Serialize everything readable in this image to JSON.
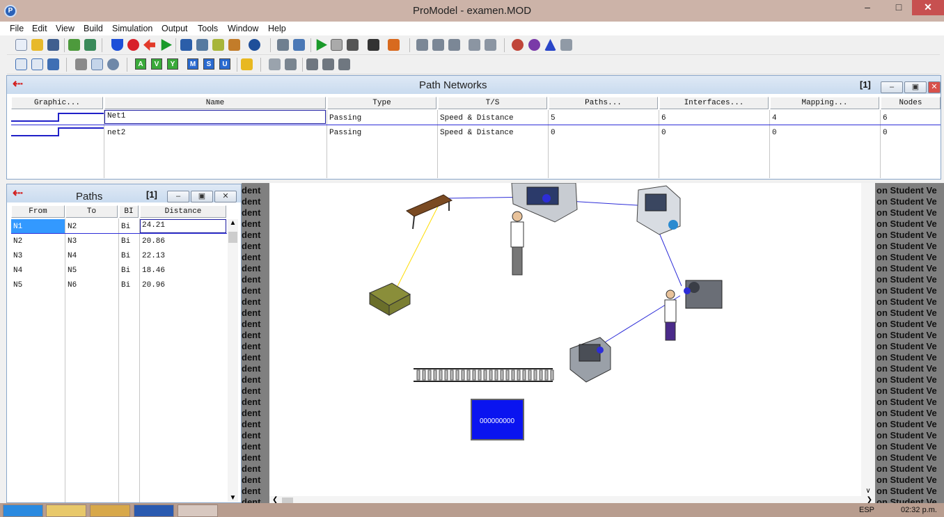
{
  "window": {
    "title": "ProModel - examen.MOD",
    "minimize": "–",
    "maximize": "□",
    "close": "✕"
  },
  "menu": [
    "File",
    "Edit",
    "View",
    "Build",
    "Simulation",
    "Output",
    "Tools",
    "Window",
    "Help"
  ],
  "path_networks": {
    "title": "Path Networks",
    "index": "[1]",
    "columns": [
      "Graphic...",
      "Name",
      "Type",
      "T/S",
      "Paths...",
      "Interfaces...",
      "Mapping...",
      "Nodes"
    ],
    "rows": [
      {
        "name": "Net1",
        "type": "Passing",
        "ts": "Speed & Distance",
        "paths": "5",
        "interfaces": "6",
        "mapping": "4",
        "nodes": "6"
      },
      {
        "name": "net2",
        "type": "Passing",
        "ts": "Speed & Distance",
        "paths": "0",
        "interfaces": "0",
        "mapping": "0",
        "nodes": "0"
      }
    ]
  },
  "paths": {
    "title": "Paths",
    "index": "[1]",
    "columns": [
      "From",
      "To",
      "BI",
      "Distance"
    ],
    "rows": [
      {
        "from": "N1",
        "to": "N2",
        "bi": "Bi",
        "distance": "24.21"
      },
      {
        "from": "N2",
        "to": "N3",
        "bi": "Bi",
        "distance": "20.86"
      },
      {
        "from": "N3",
        "to": "N4",
        "bi": "Bi",
        "distance": "22.13"
      },
      {
        "from": "N4",
        "to": "N5",
        "bi": "Bi",
        "distance": "18.46"
      },
      {
        "from": "N5",
        "to": "N6",
        "bi": "Bi",
        "distance": "20.96"
      }
    ]
  },
  "layout": {
    "left_text": "dent",
    "right_text": "on Student Ve",
    "counter": "000000000"
  },
  "toolbar2_letters": [
    "A",
    "V",
    "Y",
    "M",
    "S",
    "U"
  ],
  "taskbar": {
    "lang": "ESP",
    "clock": "02:32 p.m."
  },
  "colors": {
    "accent": "#0000ff",
    "path_line": "#2d2dd8",
    "counter_bg": "#0a14f0",
    "titlebar": "#ccb3a8"
  }
}
